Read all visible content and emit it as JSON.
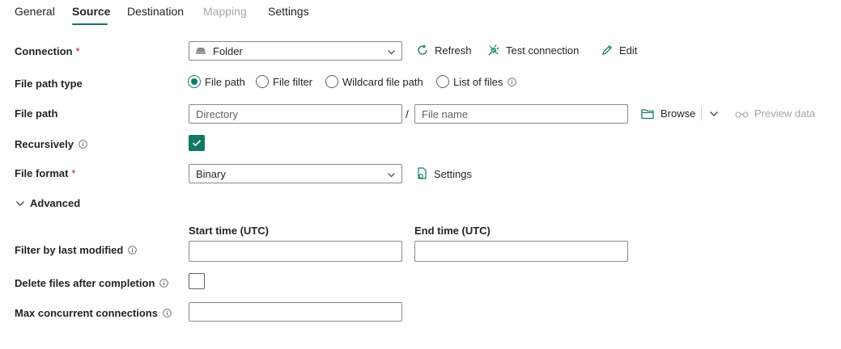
{
  "tabs": [
    {
      "label": "General",
      "state": "normal"
    },
    {
      "label": "Source",
      "state": "active"
    },
    {
      "label": "Destination",
      "state": "normal"
    },
    {
      "label": "Mapping",
      "state": "disabled"
    },
    {
      "label": "Settings",
      "state": "normal"
    }
  ],
  "accent_color": "#117865",
  "connection": {
    "label": "Connection",
    "required_mark": "*",
    "value": "Folder",
    "refresh_label": "Refresh",
    "test_label": "Test connection",
    "edit_label": "Edit"
  },
  "file_path_type": {
    "label": "File path type",
    "options": [
      "File path",
      "File filter",
      "Wildcard file path",
      "List of files"
    ],
    "selected": "File path"
  },
  "file_path": {
    "label": "File path",
    "directory_placeholder": "Directory",
    "separator": "/",
    "filename_placeholder": "File name",
    "browse_label": "Browse",
    "preview_label": "Preview data"
  },
  "recursively": {
    "label": "Recursively",
    "checked": true
  },
  "file_format": {
    "label": "File format",
    "required_mark": "*",
    "value": "Binary",
    "settings_label": "Settings"
  },
  "advanced": {
    "label": "Advanced",
    "expanded": true
  },
  "filter_last_modified": {
    "label": "Filter by last modified",
    "start_label": "Start time (UTC)",
    "end_label": "End time (UTC)",
    "start_value": "",
    "end_value": ""
  },
  "delete_files": {
    "label": "Delete files after completion",
    "checked": false
  },
  "max_connections": {
    "label": "Max concurrent connections",
    "value": ""
  }
}
